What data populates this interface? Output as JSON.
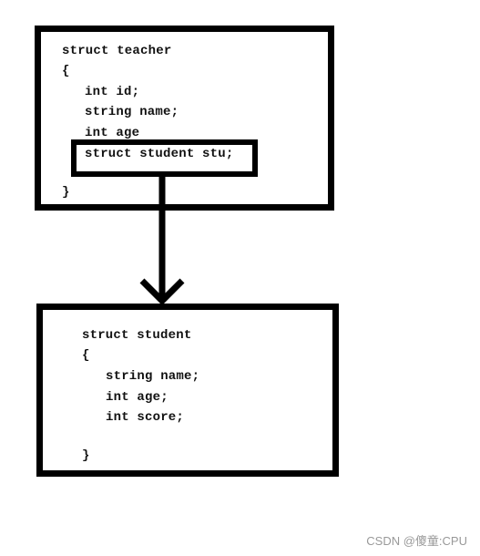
{
  "teacher": {
    "lines": [
      "struct teacher",
      "{",
      "int id;",
      "string name;",
      "int age",
      "}"
    ],
    "highlighted_member": "struct student stu;"
  },
  "student": {
    "lines": [
      "struct student",
      "{",
      "string name;",
      "int age;",
      "int score;",
      "}"
    ]
  },
  "watermark": "CSDN @傻童:CPU"
}
